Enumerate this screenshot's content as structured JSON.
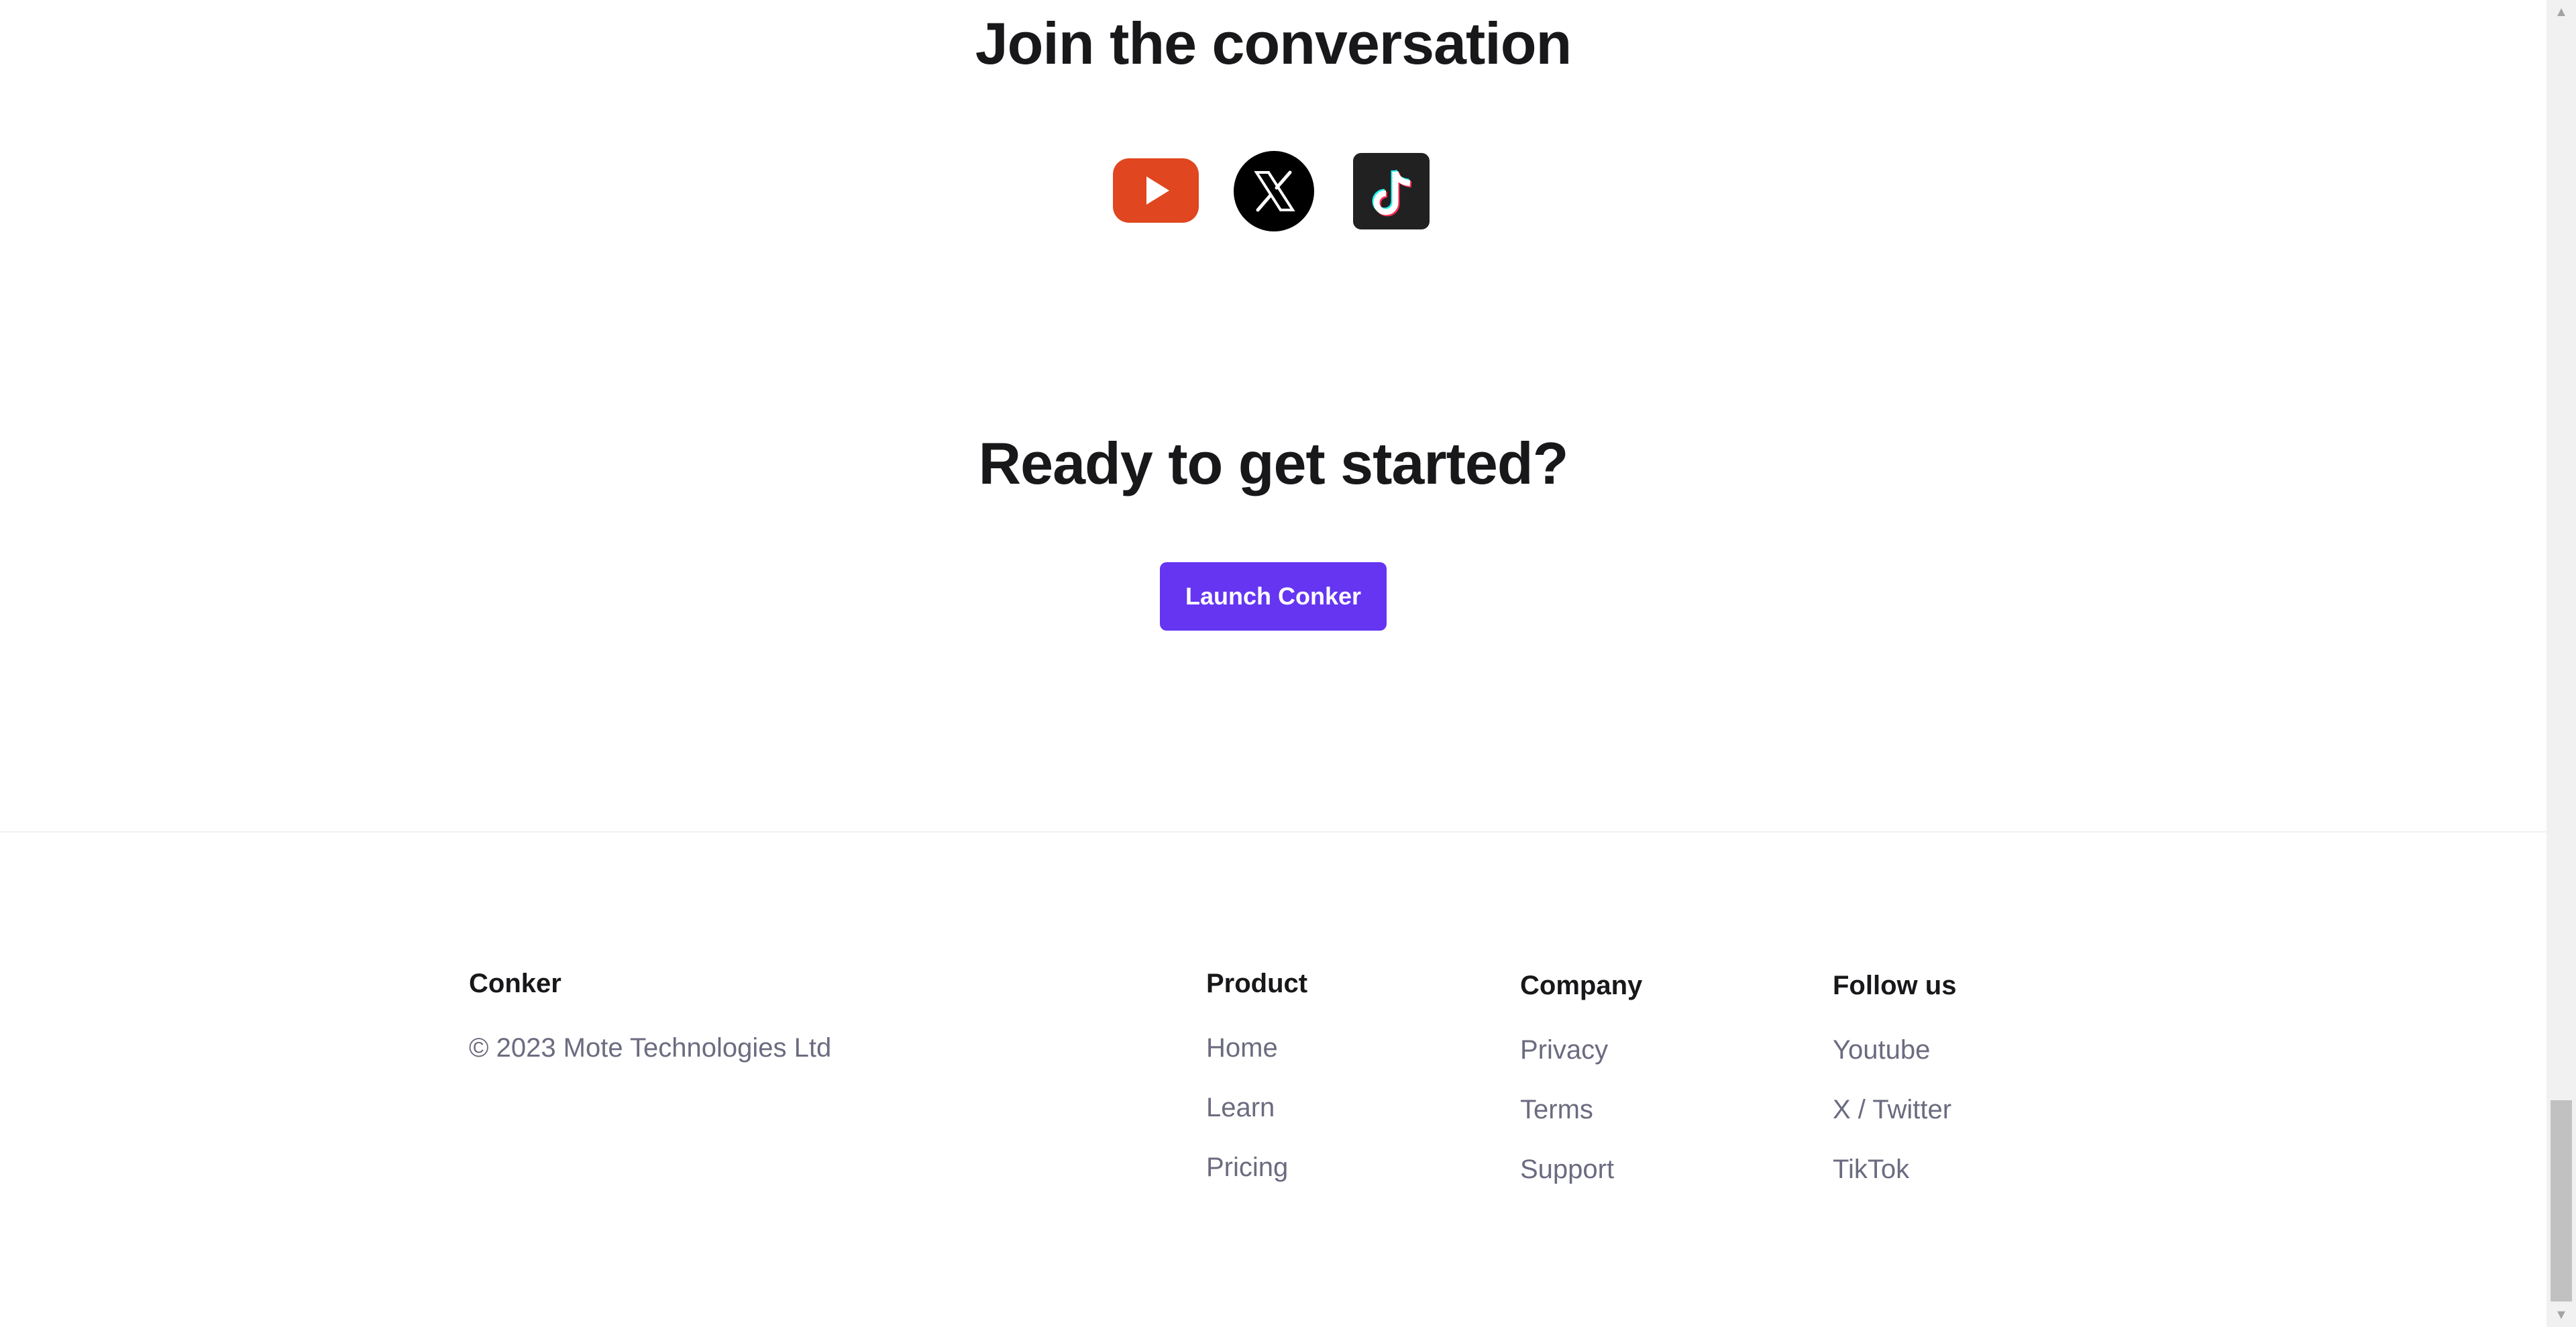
{
  "join": {
    "heading": "Join the conversation",
    "socials": [
      {
        "name": "youtube-icon",
        "color": "#e0461f"
      },
      {
        "name": "x-twitter-icon",
        "color": "#000000"
      },
      {
        "name": "tiktok-icon",
        "color": "#212121"
      }
    ]
  },
  "cta": {
    "heading": "Ready to get started?",
    "button_label": "Launch Conker",
    "button_color": "#6535f2"
  },
  "footer": {
    "brand": {
      "title": "Conker",
      "copyright": "© 2023 Mote Technologies Ltd"
    },
    "product": {
      "title": "Product",
      "links": [
        "Home",
        "Learn",
        "Pricing"
      ]
    },
    "company": {
      "title": "Company",
      "links": [
        "Privacy",
        "Terms",
        "Support"
      ]
    },
    "follow": {
      "title": "Follow us",
      "links": [
        "Youtube",
        "X / Twitter",
        "TikTok"
      ]
    }
  },
  "colors": {
    "heading_text": "#18181b",
    "muted_text": "#6b6b80",
    "accent": "#6535f2"
  }
}
